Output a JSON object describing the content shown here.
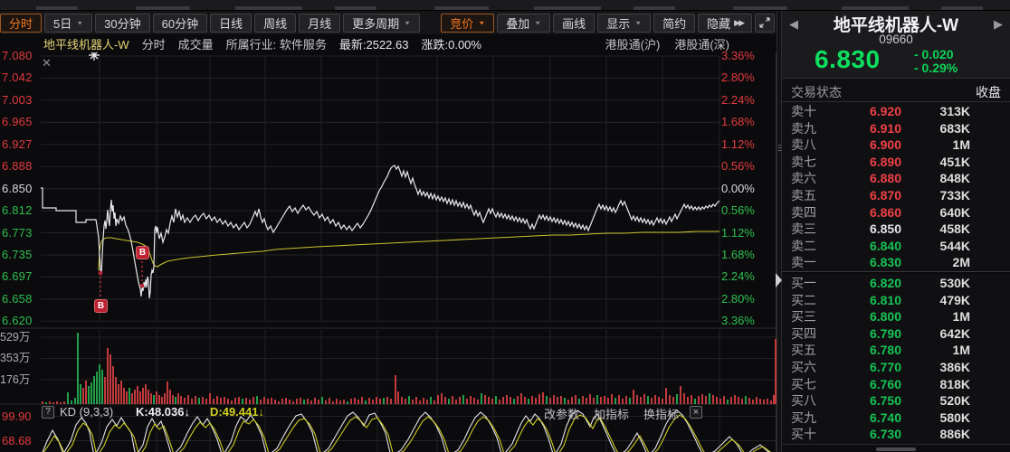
{
  "toolbar": {
    "left": [
      {
        "label": "分时",
        "active": true,
        "caret": false
      },
      {
        "label": "5日",
        "active": false,
        "caret": true
      },
      {
        "label": "30分钟",
        "active": false,
        "caret": false
      },
      {
        "label": "60分钟",
        "active": false,
        "caret": false
      },
      {
        "label": "日线",
        "active": false,
        "caret": false
      },
      {
        "label": "周线",
        "active": false,
        "caret": false
      },
      {
        "label": "月线",
        "active": false,
        "caret": false
      },
      {
        "label": "更多周期",
        "active": false,
        "caret": true
      }
    ],
    "right": [
      {
        "label": "竞价",
        "active": true,
        "caret": true
      },
      {
        "label": "叠加",
        "active": false,
        "caret": true
      },
      {
        "label": "画线",
        "active": false,
        "caret": false
      },
      {
        "label": "显示",
        "active": false,
        "caret": true
      },
      {
        "label": "简约",
        "active": false,
        "caret": false
      },
      {
        "label": "隐藏",
        "active": false,
        "caret": false,
        "suffix": "▶▶"
      }
    ]
  },
  "chart_header": {
    "stock_name": "地平线机器人-W",
    "period": "分时",
    "volume_label": "成交量",
    "industry": "所属行业: 软件服务",
    "latest": "最新:2522.63",
    "change": "涨跌:0.00%",
    "tags": [
      "港股通(沪)",
      "港股通(深)"
    ]
  },
  "close_icon": "✕",
  "price_axis": [
    {
      "label": "7.080",
      "color": "red"
    },
    {
      "label": "7.042",
      "color": "red"
    },
    {
      "label": "7.003",
      "color": "red"
    },
    {
      "label": "6.965",
      "color": "red"
    },
    {
      "label": "6.927",
      "color": "red"
    },
    {
      "label": "6.888",
      "color": "red"
    },
    {
      "label": "6.850",
      "color": "white"
    },
    {
      "label": "6.812",
      "color": "green"
    },
    {
      "label": "6.773",
      "color": "green"
    },
    {
      "label": "6.735",
      "color": "green"
    },
    {
      "label": "6.697",
      "color": "green"
    },
    {
      "label": "6.658",
      "color": "green"
    },
    {
      "label": "6.620",
      "color": "green"
    }
  ],
  "pct_axis": [
    {
      "label": "3.36%",
      "color": "red"
    },
    {
      "label": "2.80%",
      "color": "red"
    },
    {
      "label": "2.24%",
      "color": "red"
    },
    {
      "label": "1.68%",
      "color": "red"
    },
    {
      "label": "1.12%",
      "color": "red"
    },
    {
      "label": "0.56%",
      "color": "red"
    },
    {
      "label": "0.00%",
      "color": "white"
    },
    {
      "label": "0.56%",
      "color": "green"
    },
    {
      "label": "1.12%",
      "color": "green"
    },
    {
      "label": "1.68%",
      "color": "green"
    },
    {
      "label": "2.24%",
      "color": "green"
    },
    {
      "label": "2.80%",
      "color": "green"
    },
    {
      "label": "3.36%",
      "color": "green"
    }
  ],
  "volume_axis": [
    "529万",
    "353万",
    "176万"
  ],
  "kd_panel": {
    "help": "?",
    "title": "KD (9,3,3)",
    "k_label": "K:48.036↓",
    "d_label": "D:49.441↓",
    "actions": [
      "改参数",
      "加指标",
      "换指标"
    ],
    "close": "×",
    "axis": [
      "99.90",
      "68.68"
    ]
  },
  "markers": {
    "buy": "B"
  },
  "right_panel": {
    "prev_arrow": "◀",
    "next_arrow": "▶",
    "name": "地平线机器人-W",
    "code": "09660",
    "price": "6.830",
    "change": "- 0.020",
    "change_pct": "- 0.29%",
    "status_label": "交易状态",
    "status_value": "收盘",
    "asks": [
      [
        "卖十",
        "6.920",
        "red",
        "313K"
      ],
      [
        "卖九",
        "6.910",
        "red",
        "683K"
      ],
      [
        "卖八",
        "6.900",
        "red",
        "1M"
      ],
      [
        "卖七",
        "6.890",
        "red",
        "451K"
      ],
      [
        "卖六",
        "6.880",
        "red",
        "848K"
      ],
      [
        "卖五",
        "6.870",
        "red",
        "733K"
      ],
      [
        "卖四",
        "6.860",
        "red",
        "640K"
      ],
      [
        "卖三",
        "6.850",
        "white",
        "458K"
      ],
      [
        "卖二",
        "6.840",
        "green",
        "544K"
      ],
      [
        "卖一",
        "6.830",
        "green",
        "2M"
      ]
    ],
    "bids": [
      [
        "买一",
        "6.820",
        "green",
        "530K"
      ],
      [
        "买二",
        "6.810",
        "green",
        "479K"
      ],
      [
        "买三",
        "6.800",
        "green",
        "1M"
      ],
      [
        "买四",
        "6.790",
        "green",
        "642K"
      ],
      [
        "买五",
        "6.780",
        "green",
        "1M"
      ],
      [
        "买六",
        "6.770",
        "green",
        "386K"
      ],
      [
        "买七",
        "6.760",
        "green",
        "818K"
      ],
      [
        "买八",
        "6.750",
        "green",
        "520K"
      ],
      [
        "买九",
        "6.740",
        "green",
        "580K"
      ],
      [
        "买十",
        "6.730",
        "green",
        "886K"
      ]
    ]
  },
  "chart_data": {
    "type": "line",
    "title": "地平线机器人-W 分时",
    "prev_close": 6.85,
    "last": 6.83,
    "price_ticks": [
      7.08,
      7.042,
      7.003,
      6.965,
      6.927,
      6.888,
      6.85,
      6.812,
      6.773,
      6.735,
      6.697,
      6.658,
      6.62
    ],
    "pct_ticks": [
      "3.36%",
      "2.80%",
      "2.24%",
      "1.68%",
      "1.12%",
      "0.56%",
      "0.00%",
      "-0.56%",
      "-1.12%",
      "-1.68%",
      "-2.24%",
      "-2.80%",
      "-3.36%"
    ],
    "volume_ticks_wan": [
      529,
      353,
      176
    ],
    "kd_values": {
      "k": 48.036,
      "d": 49.441
    },
    "price_line": "45,208 47,208 47,230 62,230 62,233 84,233 84,246 95,246 95,243 106,243 107,249 109,263 110,282 111,298 112,304 113,282 114,263 115,250 116,244 117,253 118,244 119,232 120,243 121,250 122,232 123,221 124,234 125,227 126,242 127,235 128,250 129,242 131,247 133,239 135,244 137,240 139,249 141,253 143,259 145,267 147,278 149,290 151,301 153,312 155,320 156,328 157,317 158,322 159,312 160,318 161,309 162,318 163,306 164,310 165,330 166,323 167,304 168,299 169,302 170,295 171,254 172,250 173,258 174,251 176,264 178,258 180,268 182,262 184,254 186,258 188,247 190,239 192,246 194,231 196,240 198,234 200,243 202,238 204,246 207,241 210,246 213,241 216,238 219,244 222,239 225,236 228,242 231,238 234,244 237,240 240,246 243,242 246,248 249,244 252,250 255,246 258,252 261,248 264,254 267,250 270,246 273,252 276,248 279,241 282,234 284,239 286,231 288,240 290,246 292,242 294,249 296,254 299,250 302,257 305,252 308,247 311,242 314,237 317,232 320,228 323,234 326,230 329,236 332,231 335,227 338,232 341,229 344,234 347,238 350,234 353,241 356,237 359,244 362,240 365,247 368,243 371,250 374,246 377,253 380,249 383,254 386,250 389,255 392,251 395,247 398,252 401,248 404,243 407,238 410,232 413,225 416,218 419,211 422,206 425,200 428,195 430,190 432,186 434,184 436,183 438,187 440,184 442,189 444,195 446,189 448,196 450,190 452,197 454,203 456,197 458,204 460,209 462,215 464,210 466,216 468,212 470,217 472,213 474,219 476,214 478,220 480,215 482,221 484,217 486,222 488,218 490,223 492,219 494,225 496,220 498,226 500,221 502,227 504,222 506,228 508,224 510,229 512,224 514,230 516,226 518,231 520,227 522,233 524,238 526,233 528,239 530,235 532,241 534,246 536,241 538,236 540,231 542,236 544,231 546,236 548,240 550,235 552,240 554,236 556,241 558,237 560,242 562,238 564,243 566,239 568,244 570,240 572,245 574,241 576,246 578,242 580,247 582,243 584,249 586,253 588,248 590,253 592,248 594,243 596,238 598,242 600,238 602,243 604,239 606,244 608,240 610,245 612,241 614,246 616,242 618,247 620,243 622,248 624,244 626,249 628,245 630,250 632,246 634,251 636,247 638,252 640,248 642,253 644,249 646,254 648,250 650,255 652,250 654,245 656,240 658,235 660,230 662,226 664,231 666,227 668,232 670,228 672,233 674,229 676,234 678,230 680,235 682,231 684,226 686,222 688,227 690,223 692,228 694,233 696,238 698,243 700,239 702,244 704,240 706,245 708,241 710,246 712,242 714,247 716,243 718,248 720,244 722,249 724,245 726,241 728,246 730,242 732,247 734,243 736,248 738,244 740,240 742,245 744,241 746,237 748,242 750,238 752,234 754,230 756,226 758,230 760,227 762,231 764,228 766,232 768,229 770,232 772,229 774,232 776,229 778,231 780,228 782,230 784,227 786,229 788,226 790,228 792,225 794,223 795,222",
    "avg_line": "109,299 110,277 112,267 115,264 118,263 123,263 128,264 134,265 140,266 146,267 152,268 157,270 161,272 164,276 167,285 169,291 171,294 174,295 177,293 181,291 185,289 190,288 196,287 202,286 210,285 220,284 230,283 240,282 252,281 264,280 276,279 290,278 304,276 318,275 334,274 350,273 370,272 390,271 410,270 430,269 450,268 470,267 490,266 510,265 530,264 550,263 570,262 590,261 610,260 630,260 650,259 670,258 690,258 710,257 730,257 750,257 770,256 795,256",
    "volume_bars": "47:3:r 51:2:g 55:3:r 59:2:r 63:3:r 67:2:r 71:3:r 75:13:g 79:4:g 83:7:g 86:79:g 89:22:g 92:18:r 95:26:r 98:20:g 101:24:g 104:31:g 107:36:g 110:44:g 113:38:g 116:30:r 119:62:r 122:55:r 125:42:r 128:30:r 131:22:r 134:26:r 137:18:r 140:14:r 143:18:g 146:12:r 149:16:r 152:20:r 155:14:r 158:18:r 161:22:r 164:16:r 167:12:r 170:10:g 173:14:r 176:10:r 179:8:r 182:12:r 185:25:r 188:16:r 191:10:r 194:8:g 197:12:r 200:9:r 204:7:r 208:10:r 212:6:r 216:9:r 220:7:g 224:8:r 228:6:r 232:12:r 236:6:r 240:9:r 244:7:r 248:8:r 252:6:r 256:4:r 260:7:r 264:8:r 268:6:g 272:7:r 276:5:r 280:8:r 284:9:g 288:5:r 292:8:r 296:6:r 300:7:r 304:5:r 308:3:r 312:6:r 316:7:r 320:5:r 324:3:r 328:6:r 332:7:r 336:5:g 340:6:r 344:4:r 348:7:r 352:5:r 356:8:g 360:4:r 364:7:r 368:3:r 372:6:r 376:4:r 380:5:r 384:3:g 388:6:r 392:7:r 396:5:r 400:8:r 404:4:g 408:7:r 412:5:r 416:8:r 420:6:r 424:7:g 428:8:r 432:6:r 437:32:r 440:14:r 444:8:r 448:6:r 452:9:g 456:5:r 460:8:r 464:4:r 468:7:r 472:5:r 476:8:g 480:4:r 484:10:r 488:12:r 492:8:r 496:6:g 500:9:r 504:5:r 508:8:r 512:10:g 516:6:r 520:9:r 524:7:r 528:5:r 532:12:g 536:10:r 540:8:r 544:6:r 548:9:g 552:5:r 556:8:r 560:10:r 564:8:r 568:6:g 572:9:r 576:12:r 580:8:r 584:6:g 588:9:r 592:7:r 596:11:r 600:13:r 604:9:g 608:7:r 612:10:r 616:8:r 620:9:r 624:7:g 628:5:r 632:8:r 636:10:r 640:6:g 644:9:r 648:7:r 652:11:r 656:7:r 660:10:g 664:8:r 668:9:r 672:7:r 676:11:r 680:7:g 684:10:r 688:6:r 692:9:r 696:7:g 700:16:r 704:10:r 708:8:r 712:11:r 716:9:g 720:7:r 724:10:r 728:8:r 732:6:r 736:18:r 740:10:r 744:8:r 748:11:g 752:20:r 756:12:r 760:8:r 764:10:r 768:6:g 772:9:r 776:11:r 780:9:r 784:12:g 788:10:r 792:8:r 796:6:r 800:9:r 804:5:g 808:8:r 812:10:r 816:8:r 820:6:r 824:9:g 828:7:r 832:5:r 836:8:r 840:6:r 844:5:r 848:6:r 852:4:r 855:10:r 857:72:r",
    "kd_k_line": "45,505 52,488 58,476 64,486 70,502 78,488 84,470 90,462 95,468 99,478 104,505 112,490 118,472 124,464 129,471 134,462 139,470 145,479 150,505 158,492 163,472 168,463 173,472 178,466 183,481 190,505 200,494 207,479 213,468 218,461 224,470 229,463 234,472 240,486 246,505 255,489 261,471 266,461 272,466 277,459 283,468 289,481 295,505 306,496 314,481 321,469 327,460 333,458 339,466 345,478 352,505 363,496 371,482 378,470 384,460 390,456 396,462 402,471 408,459 414,457 420,467 426,479 432,505 443,498 451,486 458,473 464,462 470,456 476,462 482,471 488,484 494,505 506,498 513,486 519,473 525,462 531,456 537,461 543,471 549,484 555,505 566,491 571,479 576,468 581,460 586,466 591,458 596,463 601,472 606,485 612,505 620,491 626,471 632,458 638,454 644,458 648,465 652,472 656,462 660,458 665,468 670,479 676,493 682,505 692,498 698,489 704,479 710,491 716,505 724,496 730,483 736,469 742,459 748,454 754,459 760,469 766,481 772,494 778,505 790,499 798,491 806,483 814,491 822,505 832,497 840,492 848,499 856,503",
    "kd_d_line": "45,505 54,492 60,482 66,490 72,503 80,492 86,476 92,468 97,472 102,481 107,505 115,493 121,478 127,470 132,474 137,468 142,474 148,483 154,505 161,494 166,478 171,469 176,475 181,471 186,484 193,505 203,496 210,483 216,473 221,467 227,473 232,468 237,475 243,488 249,505 258,492 264,476 269,466 275,469 280,464 286,471 292,484 298,505 309,497 317,484 324,473 330,465 336,463 342,469 348,480 355,505 366,497 374,485 381,474 387,465 393,461 399,466 405,473 411,464 417,462 423,470 429,481 435,505 446,499 454,488 461,476 467,466 473,461 479,466 485,474 491,486 497,505 509,499 516,488 522,476 528,466 534,461 540,465 546,474 552,486 558,505 569,493 574,482 579,472 584,465 589,470 594,463 599,467 604,475 609,487 615,505 623,493 629,475 635,463 641,459 647,462 651,468 655,474 659,466 663,462 668,471 673,481 679,494 685,505 695,499 701,491 707,482 713,493 719,505 727,497 733,486 739,473 745,464 751,459 757,463 763,472 769,483 775,495 781,505 793,500 801,493 809,486 817,493 825,505 835,498 843,494 851,500 858,504"
  }
}
